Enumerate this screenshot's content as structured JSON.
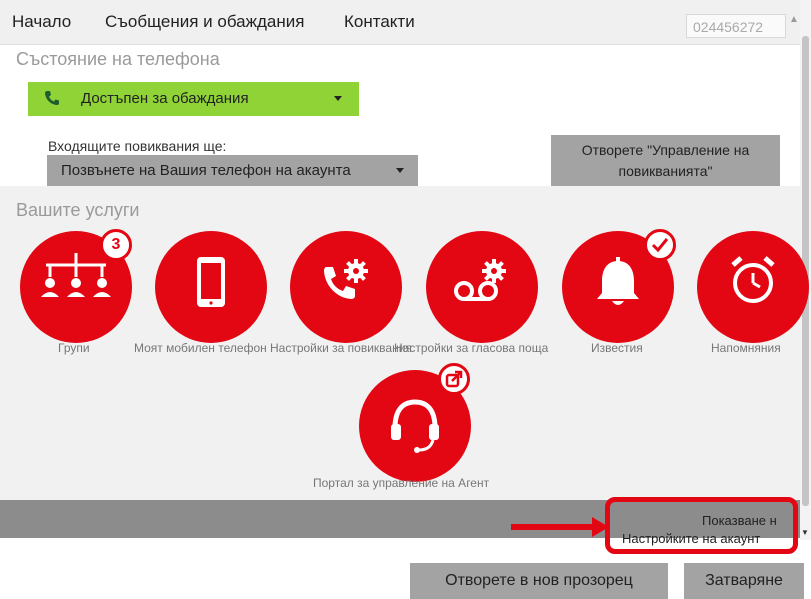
{
  "nav": {
    "items": [
      "Начало",
      "Съобщения и обаждания",
      "Контакти"
    ],
    "phone_number": "024456272"
  },
  "phone_status": {
    "title": "Състояние на телефона",
    "status_value": "Достъпен за обаждания",
    "status_color": "#8fd336",
    "incoming_label": "Входящите повиквания ще:",
    "incoming_value": "Позвънете на Вашия телефон на акаунта",
    "manage_button": "Отворете \"Управление на повикванията\""
  },
  "services": {
    "title": "Вашите услуги",
    "accent_color": "#e30613",
    "items": [
      {
        "label": "Групи",
        "icon": "groups-icon",
        "badge": "3"
      },
      {
        "label": "Моят мобилен телефон",
        "icon": "mobile-phone-icon"
      },
      {
        "label": "Настройки за повиквания",
        "icon": "call-settings-icon"
      },
      {
        "label": "Настройки за гласова поща",
        "icon": "voicemail-settings-icon"
      },
      {
        "label": "Известия",
        "icon": "bell-icon",
        "badge_icon": "checkmark-icon"
      },
      {
        "label": "Напомняния",
        "icon": "alarm-clock-icon"
      },
      {
        "label": "Портал за управление на Агент",
        "icon": "headset-icon",
        "badge_icon": "external-link-icon"
      }
    ]
  },
  "footer": {
    "line1": "Показване н",
    "line2": "Настройките на акаунт"
  },
  "buttons": {
    "open_new_window": "Отворете в нов прозорец",
    "close": "Затваряне"
  }
}
